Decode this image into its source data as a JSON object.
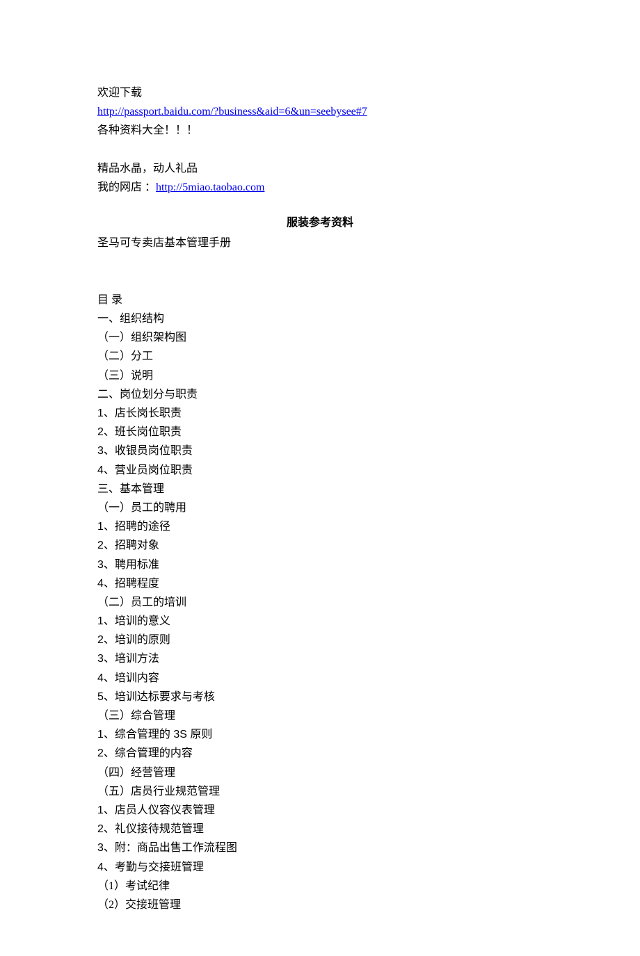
{
  "header": {
    "welcome": "欢迎下载",
    "link1_text": "http://passport.baidu.com/?business&aid=6&un=seebysee#7",
    "subtitle": "各种资料大全！！！",
    "promo": "精品水晶，动人礼品",
    "shop_label": "我的网店 ：",
    "link2_text": "http://5miao.taobao.com"
  },
  "title": "服装参考资料",
  "subtitle_line": "圣马可专卖店基本管理手册",
  "toc_heading": "目 录",
  "toc": [
    "一、组织结构",
    "（一）组织架构图",
    "（二）分工",
    "（三）说明",
    "二、岗位划分与职责",
    "1、店长岗长职责",
    "2、班长岗位职责",
    "3、收银员岗位职责",
    "4、营业员岗位职责",
    "三、基本管理",
    "（一）员工的聘用",
    "1、招聘的途径",
    "2、招聘对象",
    "3、聘用标准",
    "4、招聘程度",
    "（二）员工的培训",
    "1、培训的意义",
    "2、培训的原则",
    "3、培训方法",
    "4、培训内容",
    "5、培训达标要求与考核",
    "（三）综合管理",
    "1、综合管理的 3S 原则",
    "2、综合管理的内容",
    "（四）经营管理",
    "（五）店员行业规范管理",
    "1、店员人仪容仪表管理",
    "2、礼仪接待规范管理",
    "3、附：商品出售工作流程图",
    "4、考勤与交接班管理",
    "（1）考试纪律",
    "（2）交接班管理"
  ]
}
